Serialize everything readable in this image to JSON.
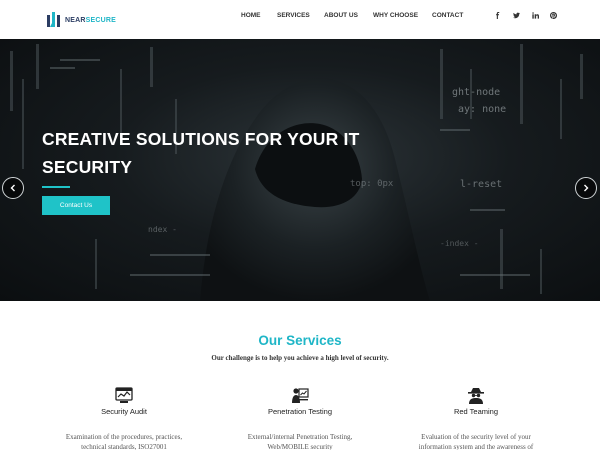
{
  "brand": {
    "name_part1": "NEAR",
    "name_part2": "SECURE"
  },
  "nav": {
    "items": [
      "HOME",
      "SERVICES",
      "ABOUT US",
      "WHY CHOOSE",
      "CONTACT"
    ]
  },
  "social_icons": [
    "facebook-icon",
    "twitter-icon",
    "linkedin-icon",
    "pinterest-icon"
  ],
  "hero": {
    "title_line1": "CREATIVE SOLUTIONS FOR YOUR IT",
    "title_line2": "SECURITY",
    "button_label": "Contact Us",
    "background_text": [
      "ght-node",
      "ay: none",
      "l-reset",
      "top: 0px",
      "ndex -",
      "-index -"
    ]
  },
  "services": {
    "title": "Our Services",
    "subtitle": "Our challenge is to help you achieve a high level of security.",
    "items": [
      {
        "icon": "security-audit-icon",
        "name": "Security Audit",
        "desc_line1": "Examination of the procedures, practices,",
        "desc_line2": "technical standards, ISO27001"
      },
      {
        "icon": "penetration-testing-icon",
        "name": "Penetration Testing",
        "desc_line1": "External/internal Penetration Testing,",
        "desc_line2": "Web/MOBILE security"
      },
      {
        "icon": "red-teaming-icon",
        "name": "Red Teaming",
        "desc_line1": "Evaluation of the security level of your",
        "desc_line2": "information system and the awareness of"
      }
    ]
  },
  "colors": {
    "accent": "#1fc3c8",
    "brand_dark": "#2b3d63",
    "title": "#1fb6c7"
  }
}
